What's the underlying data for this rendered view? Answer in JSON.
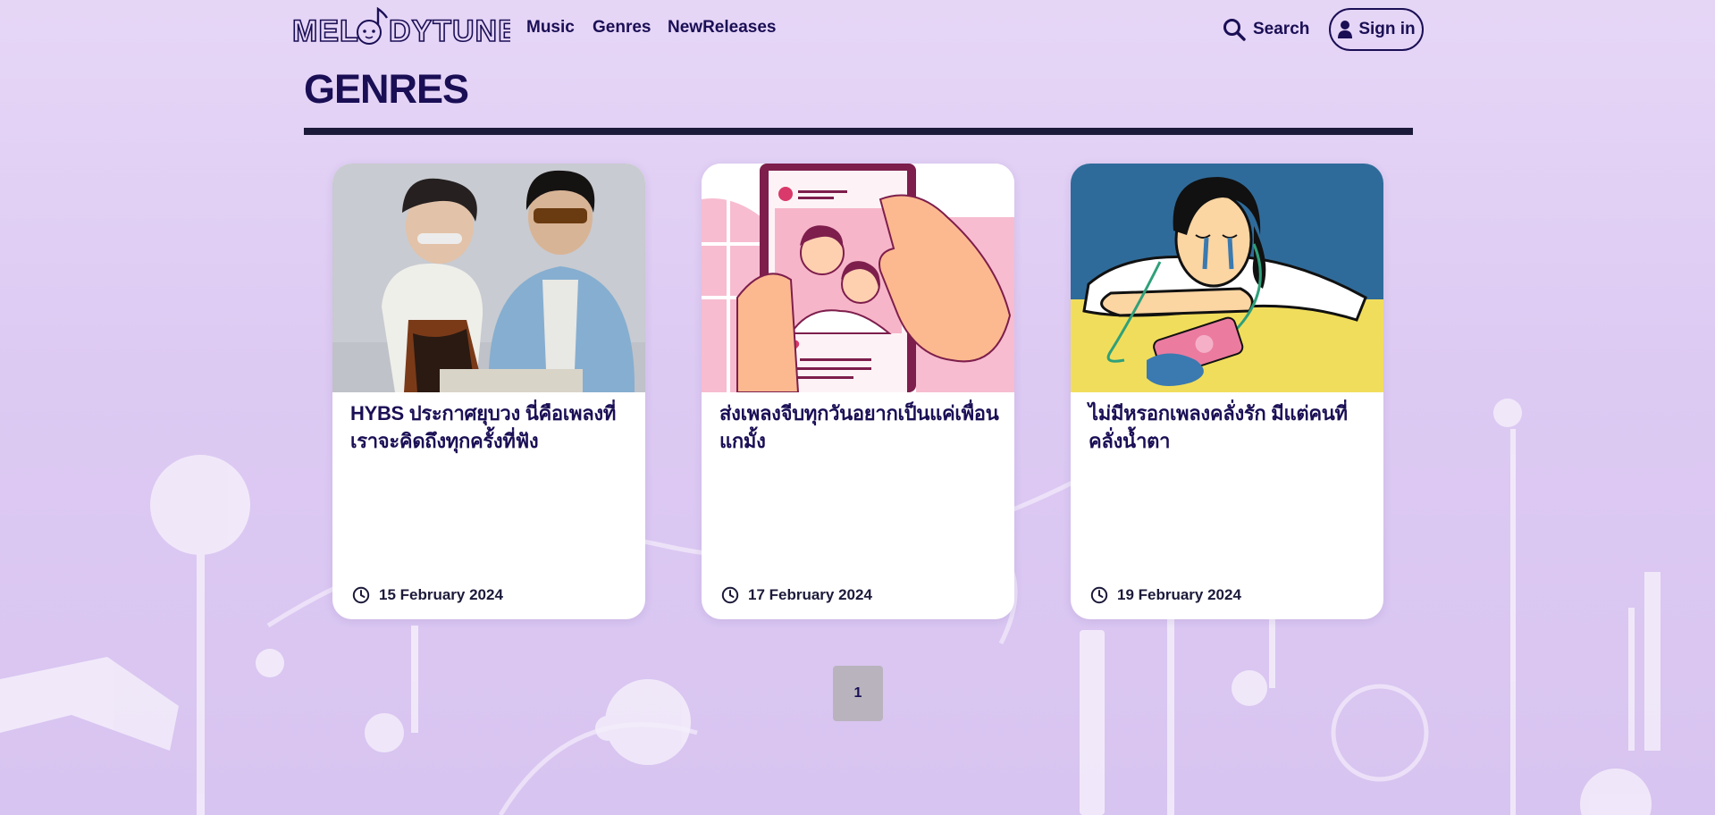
{
  "nav": {
    "logo_text": "MELODYTUNE",
    "links": [
      "Music",
      "Genres",
      "NewReleases"
    ],
    "search_label": "Search",
    "signin_label": "Sign in"
  },
  "page": {
    "title": "GENRES"
  },
  "cards": [
    {
      "title": "HYBS ประกาศยุบวง นี่คือเพลงที่เราจะคิดถึงทุกครั้งที่ฟัง",
      "date": "15 February 2024"
    },
    {
      "title": "ส่งเพลงจีบทุกวันอยากเป็นแค่เพื่อนแกมั้ง",
      "date": "17 February 2024"
    },
    {
      "title": "ไม่มีหรอกเพลงคลั่งรัก มีแต่คนที่คลั่งน้ำตา",
      "date": "19 February 2024"
    }
  ],
  "pagination": {
    "current_page": "1"
  },
  "colors": {
    "background": "#e2d1f5",
    "primary_text": "#1a0f55",
    "card_bg": "#ffffff",
    "pager_bg": "#b8b3bd"
  }
}
